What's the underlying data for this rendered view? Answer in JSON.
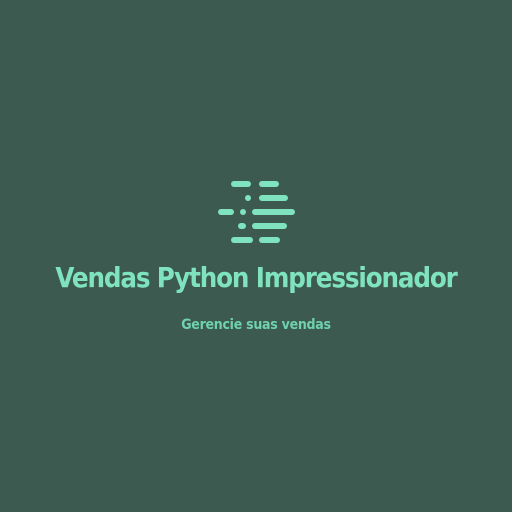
{
  "brand": {
    "title": "Vendas Python Impressionador",
    "tagline": "Gerencie suas vendas",
    "logo_icon": "code-lines-icon"
  },
  "colors": {
    "background": "#3d5a50",
    "accent": "#7fe3c0",
    "accent_dim": "#6fd1ae"
  }
}
